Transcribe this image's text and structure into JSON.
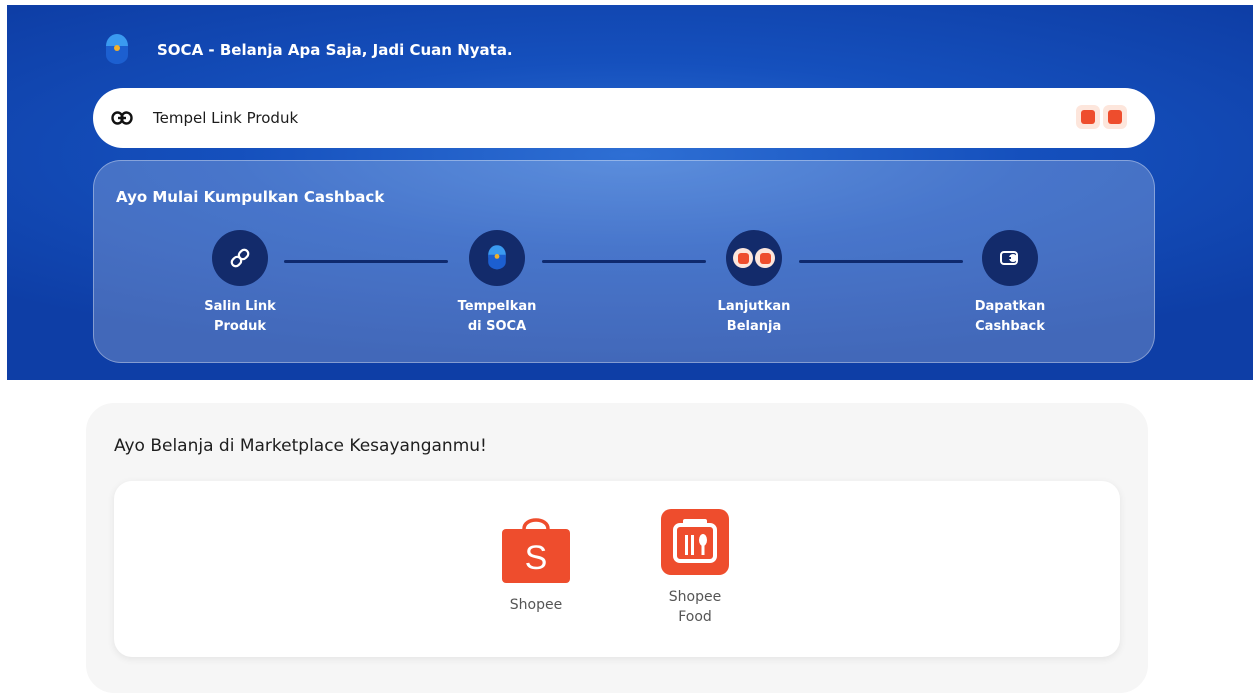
{
  "header": {
    "app_title": "SOCA - Belanja Apa Saja, Jadi Cuan Nyata."
  },
  "search": {
    "placeholder": "Tempel Link Produk",
    "icons": [
      "link-icon",
      "shopee-icon",
      "shopeefood-icon"
    ]
  },
  "steps": {
    "title": "Ayo Mulai Kumpulkan Cashback",
    "items": [
      {
        "line1": "Salin Link",
        "line2": "Produk",
        "icon": "link-icon"
      },
      {
        "line1": "Tempelkan",
        "line2": "di SOCA",
        "icon": "soca-logo-icon"
      },
      {
        "line1": "Lanjutkan",
        "line2": "Belanja",
        "icon": "shopee-icon"
      },
      {
        "line1": "Dapatkan",
        "line2": "Cashback",
        "icon": "cashback-icon"
      }
    ]
  },
  "marketplace": {
    "title": "Ayo Belanja di Marketplace Kesayanganmu!",
    "items": [
      {
        "line1": "Shopee",
        "line2": "",
        "icon": "shopee-icon"
      },
      {
        "line1": "Shopee",
        "line2": "Food",
        "icon": "shopeefood-icon"
      }
    ]
  },
  "colors": {
    "hero_blue": "#1550bd",
    "step_circle": "#132b6b",
    "shopee_orange": "#ee4d2d"
  }
}
